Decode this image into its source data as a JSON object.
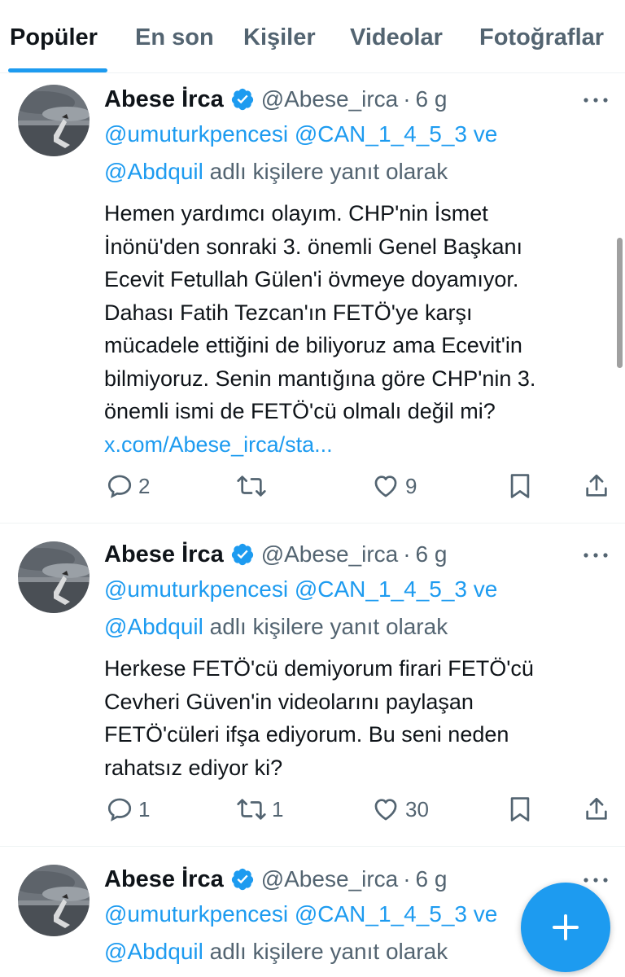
{
  "tabs": [
    {
      "label": "Popüler"
    },
    {
      "label": "En son"
    },
    {
      "label": "Kişiler"
    },
    {
      "label": "Videolar"
    },
    {
      "label": "Fotoğraflar"
    }
  ],
  "active_tab": "Popüler",
  "colors": {
    "accent": "#1d9bf0",
    "text": "#0f1419",
    "muted": "#536471"
  },
  "tweets": [
    {
      "author": {
        "name": "Abese İrca",
        "handle": "@Abese_irca",
        "verified": true
      },
      "separator": "·",
      "time": "6 g",
      "reply": {
        "mentions": [
          "@umuturkpencesi",
          "@CAN_1_4_5_3"
        ],
        "and_word": "ve",
        "last_mention": "@Abdquil",
        "suffix": "adlı kişilere yanıt olarak"
      },
      "text": "Hemen yardımcı olayım. CHP'nin İsmet\nİnönü'den sonraki 3. önemli Genel Başkanı\nEcevit Fetullah Gülen'i övmeye doyamıyor.\nDahası Fatih Tezcan'ın FETÖ'ye karşı\nmücadele ettiğini de biliyoruz ama Ecevit'in\nbilmiyoruz. Senin mantığına göre CHP'nin 3.\nönemli ismi de FETÖ'cü olmalı değil mi?",
      "link": "x.com/Abese_irca/sta...",
      "stats": {
        "replies": "2",
        "retweets": "",
        "likes": "9"
      }
    },
    {
      "author": {
        "name": "Abese İrca",
        "handle": "@Abese_irca",
        "verified": true
      },
      "separator": "·",
      "time": "6 g",
      "reply": {
        "mentions": [
          "@umuturkpencesi",
          "@CAN_1_4_5_3"
        ],
        "and_word": "ve",
        "last_mention": "@Abdquil",
        "suffix": "adlı kişilere yanıt olarak"
      },
      "text": "Herkese FETÖ'cü demiyorum firari FETÖ'cü\nCevheri Güven'in videolarını paylaşan\nFETÖ'cüleri ifşa ediyorum. Bu seni neden\nrahatsız ediyor ki?",
      "stats": {
        "replies": "1",
        "retweets": "1",
        "likes": "30"
      }
    },
    {
      "author": {
        "name": "Abese İrca",
        "handle": "@Abese_irca",
        "verified": true
      },
      "separator": "·",
      "time": "6 g",
      "reply": {
        "mentions": [
          "@umuturkpencesi",
          "@CAN_1_4_5_3"
        ],
        "and_word": "ve",
        "last_mention": "@Abdquil",
        "suffix": "adlı kişilere yanıt olarak"
      }
    }
  ],
  "icons": {
    "verified": "verified-badge-icon",
    "more": "more-dots-icon",
    "reply": "reply-bubble-icon",
    "retweet": "retweet-icon",
    "like": "heart-icon",
    "bookmark": "bookmark-icon",
    "share": "share-icon",
    "compose": "plus-icon"
  }
}
